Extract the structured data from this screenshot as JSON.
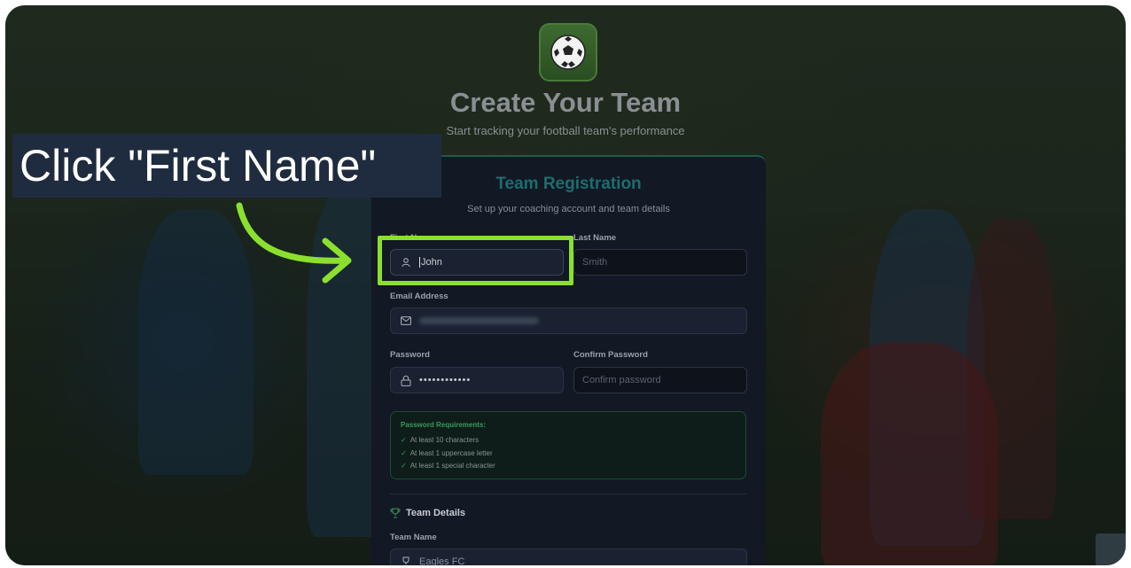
{
  "header": {
    "title": "Create Your Team",
    "subtitle": "Start tracking your football team's performance"
  },
  "card": {
    "title": "Team Registration",
    "subtitle": "Set up your coaching account and team details"
  },
  "form": {
    "first_name_label": "First Name",
    "first_name_value": "John",
    "last_name_label": "Last Name",
    "last_name_placeholder": "Smith",
    "email_label": "Email Address",
    "password_label": "Password",
    "password_value": "••••••••••••",
    "confirm_password_label": "Confirm Password",
    "confirm_password_placeholder": "Confirm password"
  },
  "requirements": {
    "title": "Password Requirements:",
    "items": [
      "At least 10 characters",
      "At least 1 uppercase letter",
      "At least 1 special character"
    ]
  },
  "team_details": {
    "section_title": "Team Details",
    "team_name_label": "Team Name",
    "team_name_value": "Eagles FC"
  },
  "tutorial": {
    "instruction": "Click \"First Name\""
  },
  "colors": {
    "accent_green": "#8be02e",
    "title_teal": "#1b6e6e",
    "tooltip_bg": "#1f2c3f"
  },
  "icons": [
    "soccer-ball-icon",
    "user-icon",
    "mail-icon",
    "lock-icon",
    "trophy-icon",
    "check-icon",
    "arrow-icon"
  ]
}
